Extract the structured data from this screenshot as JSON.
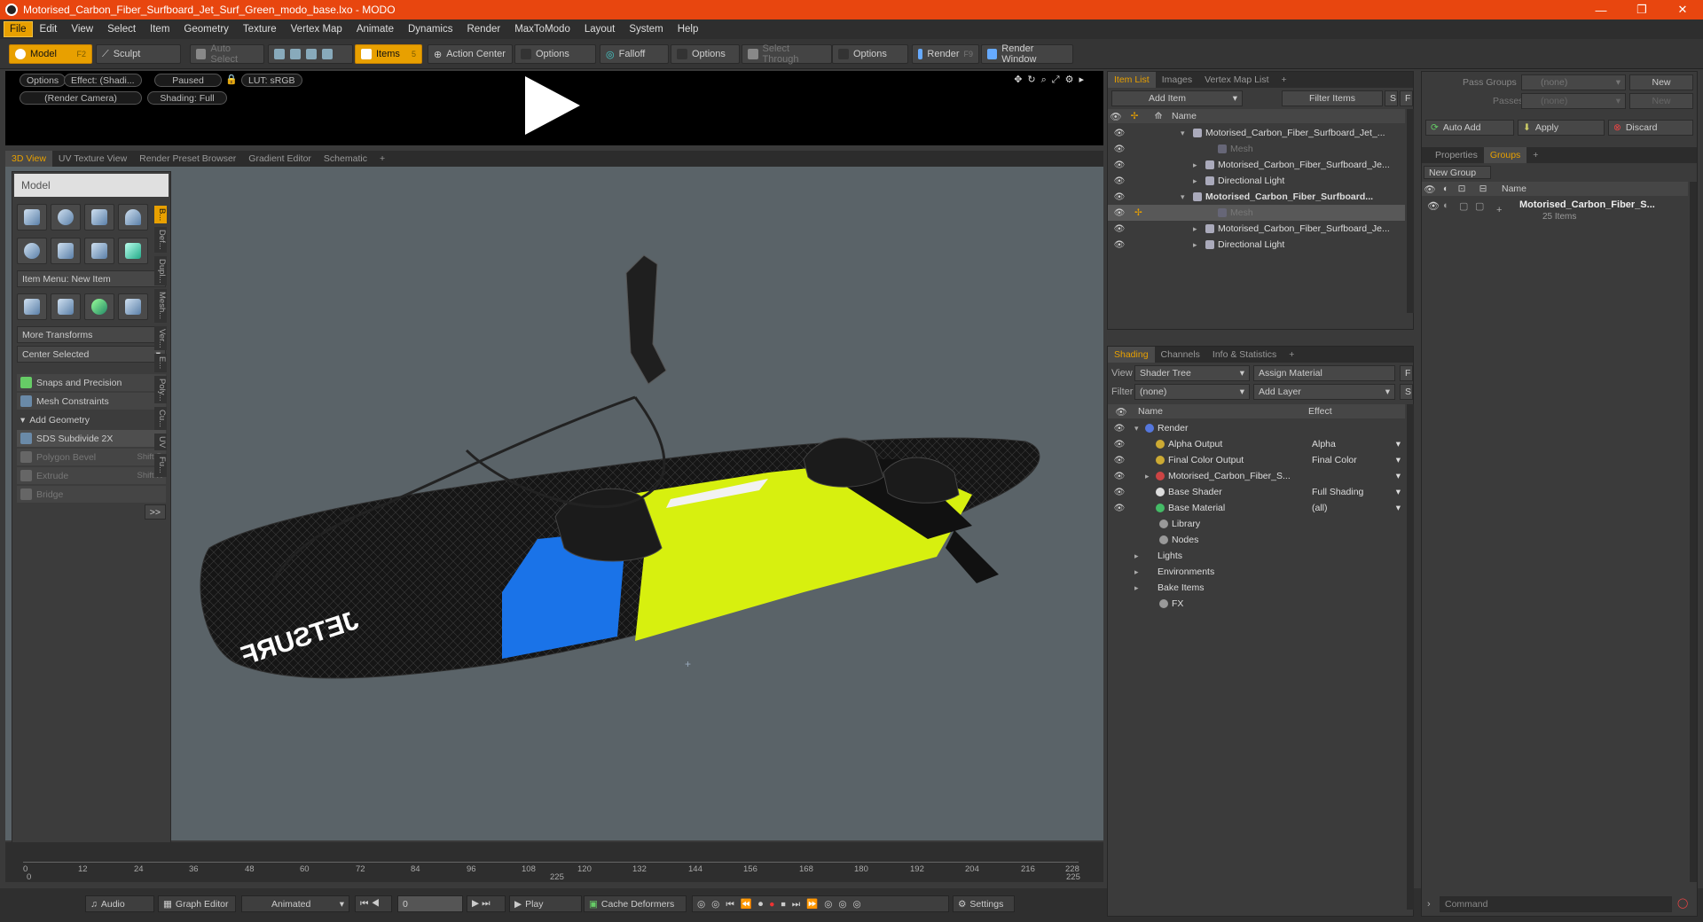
{
  "window": {
    "title": "Motorised_Carbon_Fiber_Surfboard_Jet_Surf_Green_modo_base.lxo - MODO",
    "min": "—",
    "max": "❐",
    "close": "✕"
  },
  "menu": [
    "File",
    "Edit",
    "View",
    "Select",
    "Item",
    "Geometry",
    "Texture",
    "Vertex Map",
    "Animate",
    "Dynamics",
    "Render",
    "MaxToModo",
    "Layout",
    "System",
    "Help"
  ],
  "toolbar": {
    "model": "Model",
    "model_key": "F2",
    "sculpt": "Sculpt",
    "auto_select": "Auto Select",
    "items": "Items",
    "items_key": "5",
    "action_center": "Action Center",
    "options1": "Options",
    "falloff": "Falloff",
    "options2": "Options",
    "select_through": "Select Through",
    "options3": "Options",
    "render": "Render",
    "render_key": "F9",
    "render_window": "Render Window"
  },
  "preview": {
    "options": "Options",
    "effect": "Effect: (Shadi...",
    "paused": "Paused",
    "lut": "LUT: sRGB",
    "camera": "(Render Camera)",
    "shading": "Shading: Full"
  },
  "viewport_tabs": [
    "3D View",
    "UV Texture View",
    "Render Preset Browser",
    "Gradient Editor",
    "Schematic",
    "+"
  ],
  "tool_panel": {
    "title": "Model",
    "item_menu": "Item Menu: New Item",
    "more_transforms": "More Transforms",
    "center_selected": "Center Selected",
    "snaps": "Snaps and Precision",
    "mesh_constraints": "Mesh Constraints",
    "add_geometry": "Add Geometry",
    "sds": "SDS Subdivide 2X",
    "polygon_bevel": "Polygon Bevel",
    "polygon_bevel_key": "Shift-B",
    "extrude": "Extrude",
    "extrude_key": "Shift-X",
    "bridge": "Bridge",
    "more": ">>",
    "side_tabs": [
      "B...",
      "Def...",
      "Dupl...",
      "Mesh...",
      "Ver...",
      "E...",
      "Poly...",
      "Cu...",
      "UV",
      "Fu..."
    ]
  },
  "timeline": {
    "ticks": [
      "0",
      "12",
      "24",
      "36",
      "48",
      "60",
      "72",
      "84",
      "96",
      "108",
      "120",
      "132",
      "144",
      "156",
      "168",
      "180",
      "192",
      "204",
      "216",
      "228"
    ],
    "sub": [
      "0",
      "225",
      "225"
    ]
  },
  "bottom": {
    "audio": "Audio",
    "graph_editor": "Graph Editor",
    "animated": "Animated",
    "frame": "0",
    "play": "Play",
    "cache": "Cache Deformers",
    "settings": "Settings"
  },
  "item_list": {
    "tabs": [
      "Item List",
      "Images",
      "Vertex Map List",
      "+"
    ],
    "add_item": "Add Item",
    "filter_items": "Filter Items",
    "s": "S",
    "f": "F",
    "col_name": "Name",
    "rows": [
      {
        "name": "Motorised_Carbon_Fiber_Surfboard_Jet_...",
        "indent": 0,
        "bold": false
      },
      {
        "name": "Mesh",
        "indent": 2,
        "bold": false,
        "dim": true
      },
      {
        "name": "Motorised_Carbon_Fiber_Surfboard_Je...",
        "indent": 1,
        "bold": false
      },
      {
        "name": "Directional Light",
        "indent": 1,
        "bold": false
      },
      {
        "name": "Motorised_Carbon_Fiber_Surfboard...",
        "indent": 0,
        "bold": true
      },
      {
        "name": "Mesh",
        "indent": 2,
        "bold": false,
        "dim": true,
        "sel": true
      },
      {
        "name": "Motorised_Carbon_Fiber_Surfboard_Je...",
        "indent": 1,
        "bold": false
      },
      {
        "name": "Directional Light",
        "indent": 1,
        "bold": false
      }
    ]
  },
  "shading": {
    "tabs": [
      "Shading",
      "Channels",
      "Info & Statistics",
      "+"
    ],
    "view_label": "View",
    "view_value": "Shader Tree",
    "assign_material": "Assign Material",
    "f": "F",
    "filter_label": "Filter",
    "filter_value": "(none)",
    "add_layer": "Add Layer",
    "s": "S",
    "col_name": "Name",
    "col_effect": "Effect",
    "rows": [
      {
        "name": "Render",
        "effect": "",
        "indent": 0
      },
      {
        "name": "Alpha Output",
        "effect": "Alpha",
        "indent": 1
      },
      {
        "name": "Final Color Output",
        "effect": "Final Color",
        "indent": 1
      },
      {
        "name": "Motorised_Carbon_Fiber_S...",
        "effect": "",
        "indent": 1
      },
      {
        "name": "Base Shader",
        "effect": "Full Shading",
        "indent": 1
      },
      {
        "name": "Base Material",
        "effect": "(all)",
        "indent": 1
      },
      {
        "name": "Library",
        "effect": "",
        "indent": 0
      },
      {
        "name": "Nodes",
        "effect": "",
        "indent": 0
      },
      {
        "name": "Lights",
        "effect": "",
        "indent": -1
      },
      {
        "name": "Environments",
        "effect": "",
        "indent": -1
      },
      {
        "name": "Bake Items",
        "effect": "",
        "indent": -1
      },
      {
        "name": "FX",
        "effect": "",
        "indent": 0
      }
    ]
  },
  "groups": {
    "pass_groups": "Pass Groups",
    "pass_groups_value": "(none)",
    "new": "New",
    "passes": "Passes",
    "passes_value": "(none)",
    "new2": "New",
    "auto_add": "Auto Add",
    "apply": "Apply",
    "discard": "Discard",
    "tabs": [
      "Properties",
      "Groups",
      "+"
    ],
    "new_group": "New Group",
    "col_name": "Name",
    "group_name": "Motorised_Carbon_Fiber_S...",
    "group_count": "25 Items",
    "command_placeholder": "Command"
  }
}
